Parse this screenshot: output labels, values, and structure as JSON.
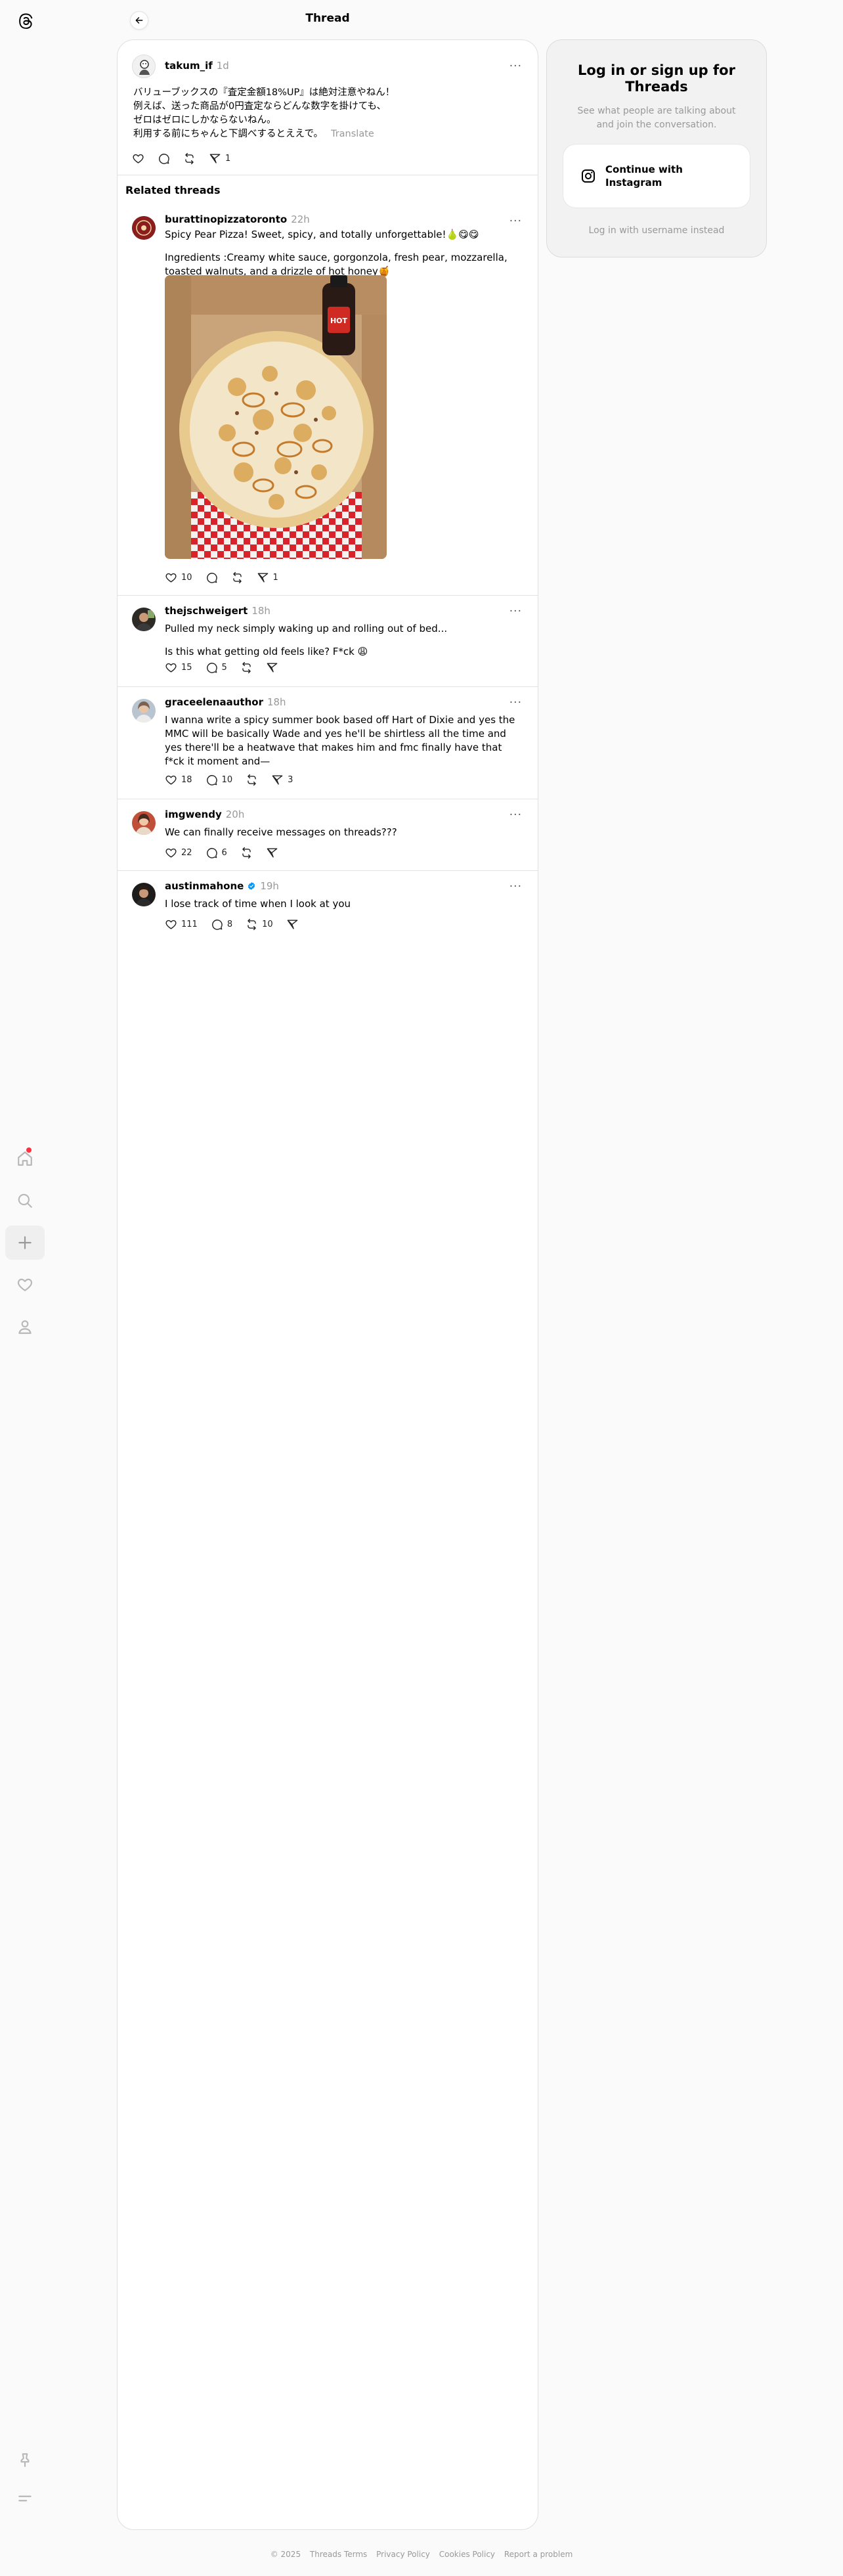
{
  "app": {
    "title": "Thread"
  },
  "nav": {
    "items": [
      {
        "name": "home",
        "icon": "home-icon"
      },
      {
        "name": "search",
        "icon": "search-icon"
      },
      {
        "name": "create",
        "icon": "plus-icon"
      },
      {
        "name": "activity",
        "icon": "heart-icon"
      },
      {
        "name": "profile",
        "icon": "person-icon"
      }
    ],
    "bottom": [
      {
        "name": "pin",
        "icon": "pin-icon"
      },
      {
        "name": "menu",
        "icon": "menu-icon"
      }
    ]
  },
  "main_post": {
    "username": "takum_if",
    "time": "1d",
    "lines": [
      "バリューブックスの『査定金額18%UP』は絶対注意やねん！",
      "例えば、送った商品が0円査定ならどんな数字を掛けても、",
      "ゼロはゼロにしかならないねん。",
      "利用する前にちゃんと下調べするとええで。"
    ],
    "translate_label": "Translate",
    "shares": "1"
  },
  "related_title": "Related threads",
  "threads": [
    {
      "username": "burattinopizzatoronto",
      "time": "22h",
      "paragraphs": [
        "Spicy Pear Pizza! Sweet, spicy, and totally unforgettable!🍐😋😋",
        "Ingredients :Creamy white sauce, gorgonzola, fresh pear, mozzarella, toasted walnuts, and a drizzle of hot honey🍯"
      ],
      "likes": "10",
      "replies": "",
      "reposts": "",
      "shares": "1",
      "photo_label": "HOT"
    },
    {
      "username": "thejschweigert",
      "time": "18h",
      "paragraphs": [
        "Pulled my neck simply waking up and rolling out of bed...",
        "Is this what getting old feels like? F*ck 😩"
      ],
      "likes": "15",
      "replies": "5",
      "reposts": "",
      "shares": ""
    },
    {
      "username": "graceelenaauthor",
      "time": "18h",
      "paragraphs": [
        "I wanna write a spicy summer book based off Hart of Dixie and yes the MMC will be basically Wade and yes he'll be shirtless all the time and yes there'll be a heatwave that makes him and fmc finally have that f*ck it moment and—"
      ],
      "likes": "18",
      "replies": "10",
      "reposts": "",
      "shares": "3"
    },
    {
      "username": "imgwendy",
      "time": "20h",
      "paragraphs": [
        "We can finally receive messages on threads???"
      ],
      "likes": "22",
      "replies": "6",
      "reposts": "",
      "shares": ""
    },
    {
      "username": "austinmahone",
      "time": "19h",
      "verified": true,
      "paragraphs": [
        "I lose track of time when I look at you"
      ],
      "likes": "111",
      "replies": "8",
      "reposts": "10",
      "shares": ""
    }
  ],
  "login": {
    "title": "Log in or sign up for Threads",
    "subtitle": "See what people are talking about and join the conversation.",
    "instagram_button": "Continue with Instagram",
    "alt_link": "Log in with username instead"
  },
  "footer": [
    "© 2025",
    "Threads Terms",
    "Privacy Policy",
    "Cookies Policy",
    "Report a problem"
  ],
  "colors": {
    "verified": "#0095f6",
    "notification": "#ff3040"
  }
}
